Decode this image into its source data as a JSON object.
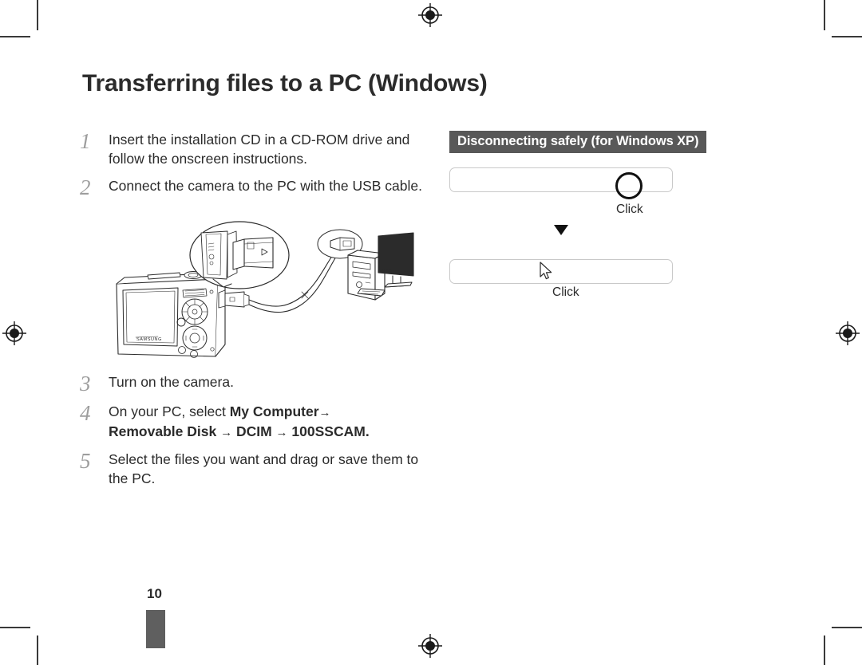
{
  "document": {
    "page_title": "Transferring files to a PC (Windows)",
    "page_number": "10"
  },
  "steps": [
    {
      "number": "1",
      "text": "Insert the installation CD in a CD-ROM drive and follow the onscreen instructions."
    },
    {
      "number": "2",
      "text": "Connect the camera to the PC with the USB cable."
    }
  ],
  "steps_lower": [
    {
      "number": "3",
      "text_before": "Turn on the camera.",
      "bold_1": "",
      "arrow_1": "",
      "bold_2": "",
      "arrow_2": "",
      "bold_3": "",
      "arrow_3": "",
      "bold_4": "",
      "text_after": ""
    },
    {
      "number": "4",
      "text_before": "On your PC, select ",
      "bold_1": "My Computer",
      "arrow_1": "→",
      "bold_2": "Removable Disk",
      "arrow_2": "→",
      "bold_3": "DCIM",
      "arrow_3": "→",
      "bold_4": "100SSCAM",
      "text_after": "."
    },
    {
      "number": "5",
      "text_before": "Select the files you want and drag or save them to the PC.",
      "bold_1": "",
      "arrow_1": "",
      "bold_2": "",
      "arrow_2": "",
      "bold_3": "",
      "arrow_3": "",
      "bold_4": "",
      "text_after": ""
    }
  ],
  "figure_camera": {
    "caption": "camera-connected-to-pc-via-usb-illustration",
    "brand_mark": "SAMSUNG"
  },
  "right_panel": {
    "banner_label": "Disconnecting safely (for Windows XP)",
    "taskbar_one_click_label": "Click",
    "taskbar_two_click_label": "Click",
    "flow_arrow": "▼"
  },
  "colors": {
    "banner_background": "#585858",
    "banner_text": "#ffffff",
    "body_text": "#2b2b2b",
    "step_number": "#9d9d9d",
    "taskbar_border": "#c9c9c9",
    "page_tab": "#5f5f5f",
    "registration_mark": "#1a1a1a"
  }
}
